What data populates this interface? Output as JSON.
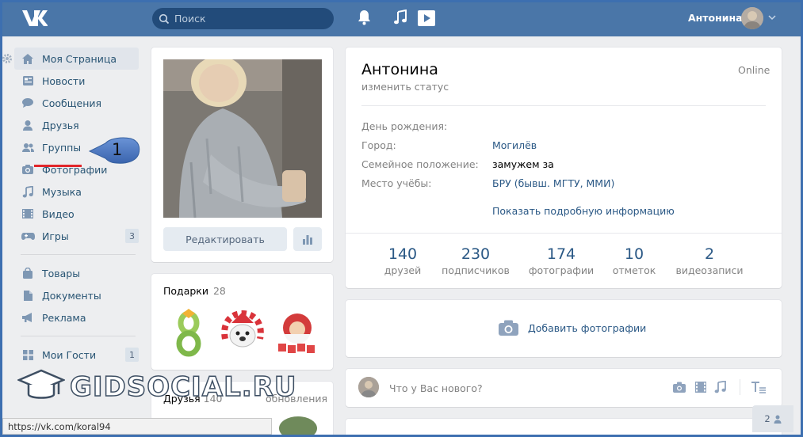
{
  "topbar": {
    "search_placeholder": "Поиск",
    "user_name": "Антонина"
  },
  "nav": {
    "items": [
      {
        "label": "Моя Страница",
        "icon": "home-icon"
      },
      {
        "label": "Новости",
        "icon": "news-icon"
      },
      {
        "label": "Сообщения",
        "icon": "messages-icon"
      },
      {
        "label": "Друзья",
        "icon": "friends-icon"
      },
      {
        "label": "Группы",
        "icon": "groups-icon"
      },
      {
        "label": "Фотографии",
        "icon": "camera-icon"
      },
      {
        "label": "Музыка",
        "icon": "music-icon"
      },
      {
        "label": "Видео",
        "icon": "video-icon"
      },
      {
        "label": "Игры",
        "icon": "games-icon",
        "badge": "3"
      },
      {
        "label": "Товары",
        "icon": "bag-icon"
      },
      {
        "label": "Документы",
        "icon": "document-icon"
      },
      {
        "label": "Реклама",
        "icon": "megaphone-icon"
      },
      {
        "label": "Мои Гости",
        "icon": "grid-icon",
        "badge": "1"
      }
    ]
  },
  "callout": {
    "number": "1"
  },
  "profile": {
    "edit_label": "Редактировать",
    "name": "Антонина",
    "status_prompt": "изменить статус",
    "online": "Online",
    "info": [
      {
        "label": "День рождения:",
        "value": ""
      },
      {
        "label": "Город:",
        "value": "Могилёв"
      },
      {
        "label": "Семейное положение:",
        "value": "замужем за"
      },
      {
        "label": "Место учёбы:",
        "value": "БРУ (бывш. МГТУ, ММИ)"
      }
    ],
    "show_more": "Показать подробную информацию",
    "stats": [
      {
        "num": "140",
        "label": "друзей"
      },
      {
        "num": "230",
        "label": "подписчиков"
      },
      {
        "num": "174",
        "label": "фотографии"
      },
      {
        "num": "10",
        "label": "отметок"
      },
      {
        "num": "2",
        "label": "видеозаписи"
      }
    ]
  },
  "gifts": {
    "title": "Подарки",
    "count": "28"
  },
  "friends": {
    "title": "Друзья",
    "count": "140",
    "updates": "обновления"
  },
  "add_photos": "Добавить фотографии",
  "post": {
    "placeholder": "Что у Вас нового?"
  },
  "watermark": "GIDSOCIAL.RU",
  "status_url": "https://vk.com/koral94",
  "messages_badge": "2"
}
